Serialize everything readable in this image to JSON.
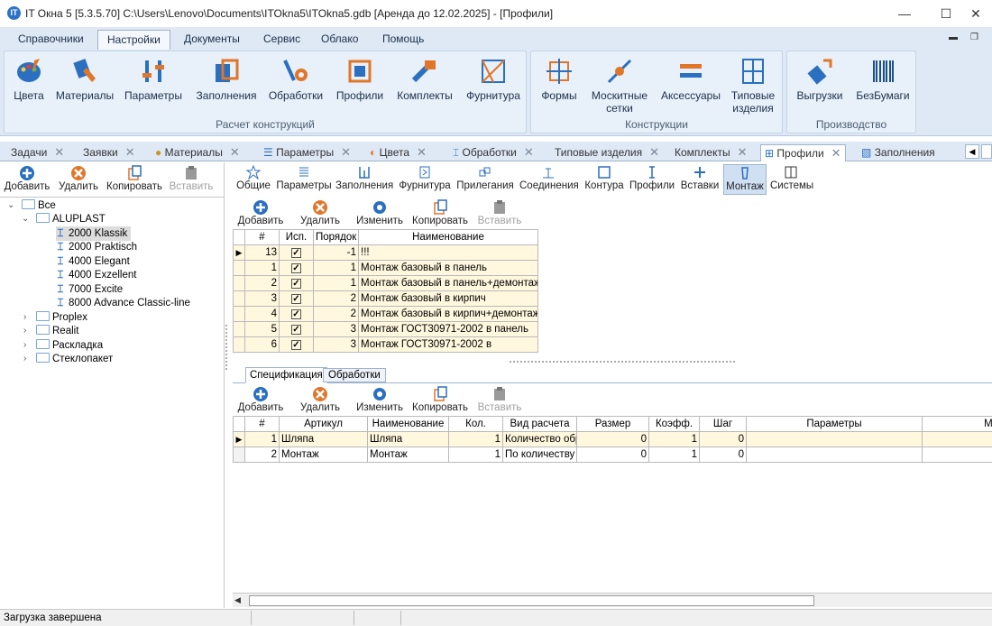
{
  "window": {
    "title": "IT Окна 5 [5.3.5.70] C:\\Users\\Lenovo\\Documents\\ITOkna5\\ITOkna5.gdb [Аренда до 12.02.2025] - [Профили]",
    "app_icon": "IT"
  },
  "menu": [
    "Справочники",
    "Настройки",
    "Документы",
    "Сервис",
    "Облако",
    "Помощь"
  ],
  "ribbon": {
    "groups": [
      {
        "label": "Расчет конструкций",
        "buttons": [
          "Цвета",
          "Материалы",
          "Параметры",
          "Заполнения",
          "Обработки",
          "Профили",
          "Комплекты",
          "Фурнитура"
        ]
      },
      {
        "label": "Конструкции",
        "buttons": [
          "Формы",
          "Москитные сетки",
          "Аксессуары",
          "Типовые изделия"
        ]
      },
      {
        "label": "Производство",
        "buttons": [
          "Выгрузки",
          "БезБумаги"
        ]
      }
    ]
  },
  "doc_tabs": [
    "Задачи",
    "Заявки",
    "Материалы",
    "Параметры",
    "Цвета",
    "Обработки",
    "Типовые изделия",
    "Комплекты",
    "Профили",
    "Заполнения"
  ],
  "left_toolbar": {
    "add": "Добавить",
    "delete": "Удалить",
    "copy": "Копировать",
    "paste": "Вставить"
  },
  "tree": {
    "root": "Все",
    "group": "ALUPLAST",
    "items": [
      "2000 Klassik",
      "2000 Praktisch",
      "4000 Elegant",
      "4000 Exzellent",
      "7000 Excite",
      "8000 Advance Classic-line"
    ],
    "others": [
      "Proplex",
      "Realit",
      "Раскладка",
      "Стеклопакет"
    ]
  },
  "sub_tabs": [
    "Общие",
    "Параметры",
    "Заполнения",
    "Фурнитура",
    "Прилегания",
    "Соединения",
    "Контура",
    "Профили",
    "Вставки",
    "Монтаж",
    "Системы"
  ],
  "top_toolbar": {
    "add": "Добавить",
    "delete": "Удалить",
    "change": "Изменить",
    "copy": "Копировать",
    "paste": "Вставить"
  },
  "top_grid": {
    "headers": [
      "#",
      "Исп.",
      "Порядок",
      "Наименование"
    ],
    "rows": [
      {
        "n": "13",
        "order": "-1",
        "name": "!!!"
      },
      {
        "n": "1",
        "order": "1",
        "name": "Монтаж базовый в панель"
      },
      {
        "n": "2",
        "order": "1",
        "name": "Монтаж базовый в панель+демонтаж"
      },
      {
        "n": "3",
        "order": "2",
        "name": "Монтаж базовый в кирпич"
      },
      {
        "n": "4",
        "order": "2",
        "name": "Монтаж базовый в кирпич+демонтаж"
      },
      {
        "n": "5",
        "order": "3",
        "name": "Монтаж ГОСТ30971-2002 в панель"
      },
      {
        "n": "6",
        "order": "3",
        "name": "Монтаж ГОСТ30971-2002 в"
      }
    ]
  },
  "bottom_tabs": [
    "Спецификация",
    "Обработки"
  ],
  "bottom_toolbar": {
    "add": "Добавить",
    "delete": "Удалить",
    "change": "Изменить",
    "copy": "Копировать",
    "paste": "Вставить"
  },
  "bottom_grid": {
    "headers": [
      "#",
      "Артикул",
      "Наименование",
      "Кол.",
      "Вид расчета",
      "Размер",
      "Коэфф.",
      "Шаг",
      "Параметры",
      "Модифи"
    ],
    "rows": [
      {
        "n": "1",
        "art": "Шляпа",
        "name": "Шляпа",
        "qty": "1",
        "calc": "Количество обр",
        "size": "0",
        "coef": "1",
        "step": "0"
      },
      {
        "n": "2",
        "art": "Монтаж",
        "name": "Монтаж",
        "qty": "1",
        "calc": "По количеству",
        "size": "0",
        "coef": "1",
        "step": "0"
      }
    ]
  },
  "status": "Загрузка завершена",
  "colors": {
    "ribbon": "#dfe9f5",
    "selected_row": "#fff7de",
    "accent": "#2a73c9"
  }
}
